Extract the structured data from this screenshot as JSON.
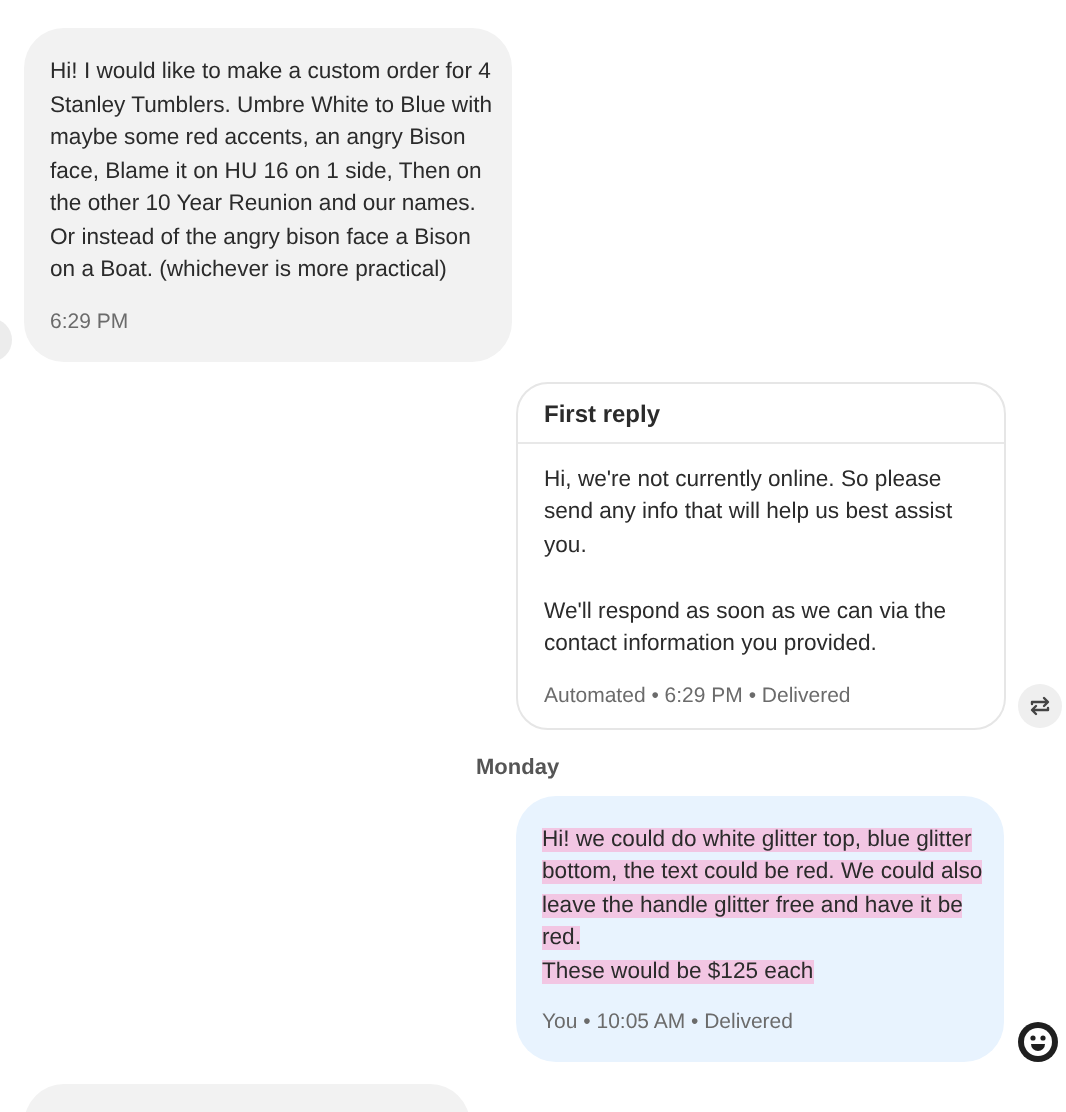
{
  "messages": [
    {
      "kind": "incoming",
      "text": "Hi! I would like to make a custom order for 4 Stanley Tumblers. Umbre White to Blue with maybe some red accents, an angry Bison face, Blame it on HU 16 on 1 side, Then on the other 10 Year Reunion and our names. Or instead of the angry bison face a Bison on a Boat. (whichever is more practical)",
      "meta": "6:29 PM"
    },
    {
      "kind": "auto-reply",
      "title": "First reply",
      "text": "Hi, we're not currently online. So please send any info that will help us best assist you.\n\nWe'll respond as soon as we can via the contact information you provided.",
      "meta": "Automated • 6:29 PM • Delivered"
    },
    {
      "kind": "date",
      "text": "Monday"
    },
    {
      "kind": "outgoing",
      "text": "Hi! we could do white glitter top, blue glitter bottom, the text could be red. We could also leave the handle glitter free and have it be red.\nThese would be $125 each",
      "meta": "You • 10:05 AM • Delivered",
      "highlighted": true
    },
    {
      "kind": "incoming-partial"
    }
  ]
}
